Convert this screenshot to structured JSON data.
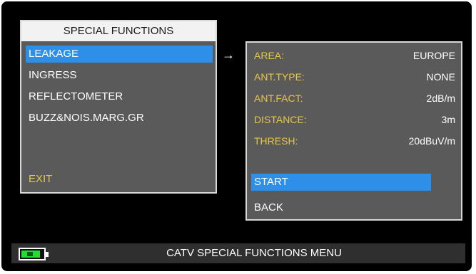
{
  "left_menu": {
    "title": "SPECIAL FUNCTIONS",
    "items": [
      "LEAKAGE",
      "INGRESS",
      "REFLECTOMETER",
      "BUZZ&NOIS.MARG.GR"
    ],
    "exit_label": "EXIT"
  },
  "arrow": "→",
  "leakage_panel": {
    "params": [
      {
        "label": "AREA:",
        "value": "EUROPE"
      },
      {
        "label": "ANT.TYPE:",
        "value": "NONE"
      },
      {
        "label": "ANT.FACT:",
        "value": "2dB/m"
      },
      {
        "label": "DISTANCE:",
        "value": "3m"
      },
      {
        "label": "THRESH:",
        "value": "20dBuV/m"
      }
    ],
    "start_label": "START",
    "back_label": "BACK"
  },
  "status_bar": {
    "title": "CATV SPECIAL FUNCTIONS MENU"
  },
  "colors": {
    "accent_blue": "#2e8fe8",
    "label_yellow": "#e6c64a",
    "panel_gray": "#5a5a5a",
    "battery_green": "#22dd33"
  }
}
